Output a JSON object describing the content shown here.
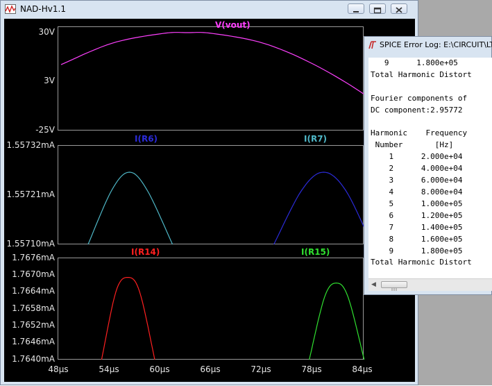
{
  "window": {
    "title": "NAD-Hv1.1"
  },
  "plot": {
    "x_ticks": [
      "48µs",
      "54µs",
      "60µs",
      "66µs",
      "72µs",
      "78µs",
      "84µs"
    ],
    "panes": [
      {
        "traces": [
          {
            "name": "V(vout)",
            "color": "#ff40ff"
          }
        ],
        "y_ticks": [
          "30V",
          "3V",
          "-25V"
        ]
      },
      {
        "traces": [
          {
            "name": "I(R6)",
            "color": "#4fb8c8"
          },
          {
            "name": "I(R7)",
            "color": "#2b2bd9"
          }
        ],
        "y_ticks": [
          "1.55732mA",
          "1.55721mA",
          "1.55710mA"
        ]
      },
      {
        "traces": [
          {
            "name": "I(R14)",
            "color": "#ff2020"
          },
          {
            "name": "I(R15)",
            "color": "#30e030"
          }
        ],
        "y_ticks": [
          "1.7676mA",
          "1.7670mA",
          "1.7664mA",
          "1.7658mA",
          "1.7652mA",
          "1.7646mA",
          "1.7640mA"
        ]
      }
    ]
  },
  "chart_data": [
    {
      "type": "line",
      "x_range_us": [
        48,
        88
      ],
      "y_unit": "V",
      "ylim": [
        -25,
        30
      ],
      "series": [
        {
          "name": "V(vout)",
          "x_us": [
            48,
            54,
            60,
            63,
            66,
            72,
            78,
            84,
            88
          ],
          "y": [
            12,
            24,
            29.5,
            30,
            29.5,
            24,
            12,
            -5,
            -21
          ]
        }
      ]
    },
    {
      "type": "line",
      "x_range_us": [
        48,
        88
      ],
      "y_unit": "mA",
      "ylim": [
        1.5571,
        1.55732
      ],
      "series": [
        {
          "name": "I(R6)",
          "x_us": [
            51.2,
            54,
            56.1,
            58.2,
            61.2
          ],
          "y": [
            1.5571,
            1.55722,
            1.55726,
            1.55722,
            1.5571
          ]
        },
        {
          "name": "I(R7)",
          "x_us": [
            73.2,
            76.5,
            79.1,
            81.7,
            84.8
          ],
          "y": [
            1.5571,
            1.55722,
            1.55726,
            1.55722,
            1.5571
          ]
        }
      ]
    },
    {
      "type": "line",
      "x_range_us": [
        48,
        88
      ],
      "y_unit": "mA",
      "ylim": [
        1.764,
        1.7676
      ],
      "series": [
        {
          "name": "I(R14)",
          "x_us": [
            52.8,
            54.5,
            55.9,
            57.3,
            59.1
          ],
          "y": [
            1.764,
            1.7664,
            1.7669,
            1.7664,
            1.764
          ]
        },
        {
          "name": "I(R15)",
          "x_us": [
            77.4,
            79.2,
            80.6,
            82,
            83.9
          ],
          "y": [
            1.764,
            1.7662,
            1.7667,
            1.7662,
            1.764
          ]
        }
      ]
    }
  ],
  "error_log": {
    "title": "SPICE Error Log: E:\\CIRCUIT\\LT",
    "lines": [
      "   9      1.800e+05",
      "Total Harmonic Distort",
      "",
      "Fourier components of",
      "DC component:2.95772",
      "",
      "Harmonic    Frequency",
      " Number       [Hz]",
      "    1      2.000e+04",
      "    2      4.000e+04",
      "    3      6.000e+04",
      "    4      8.000e+04",
      "    5      1.000e+05",
      "    6      1.200e+05",
      "    7      1.400e+05",
      "    8      1.600e+05",
      "    9      1.800e+05",
      "Total Harmonic Distort"
    ]
  }
}
